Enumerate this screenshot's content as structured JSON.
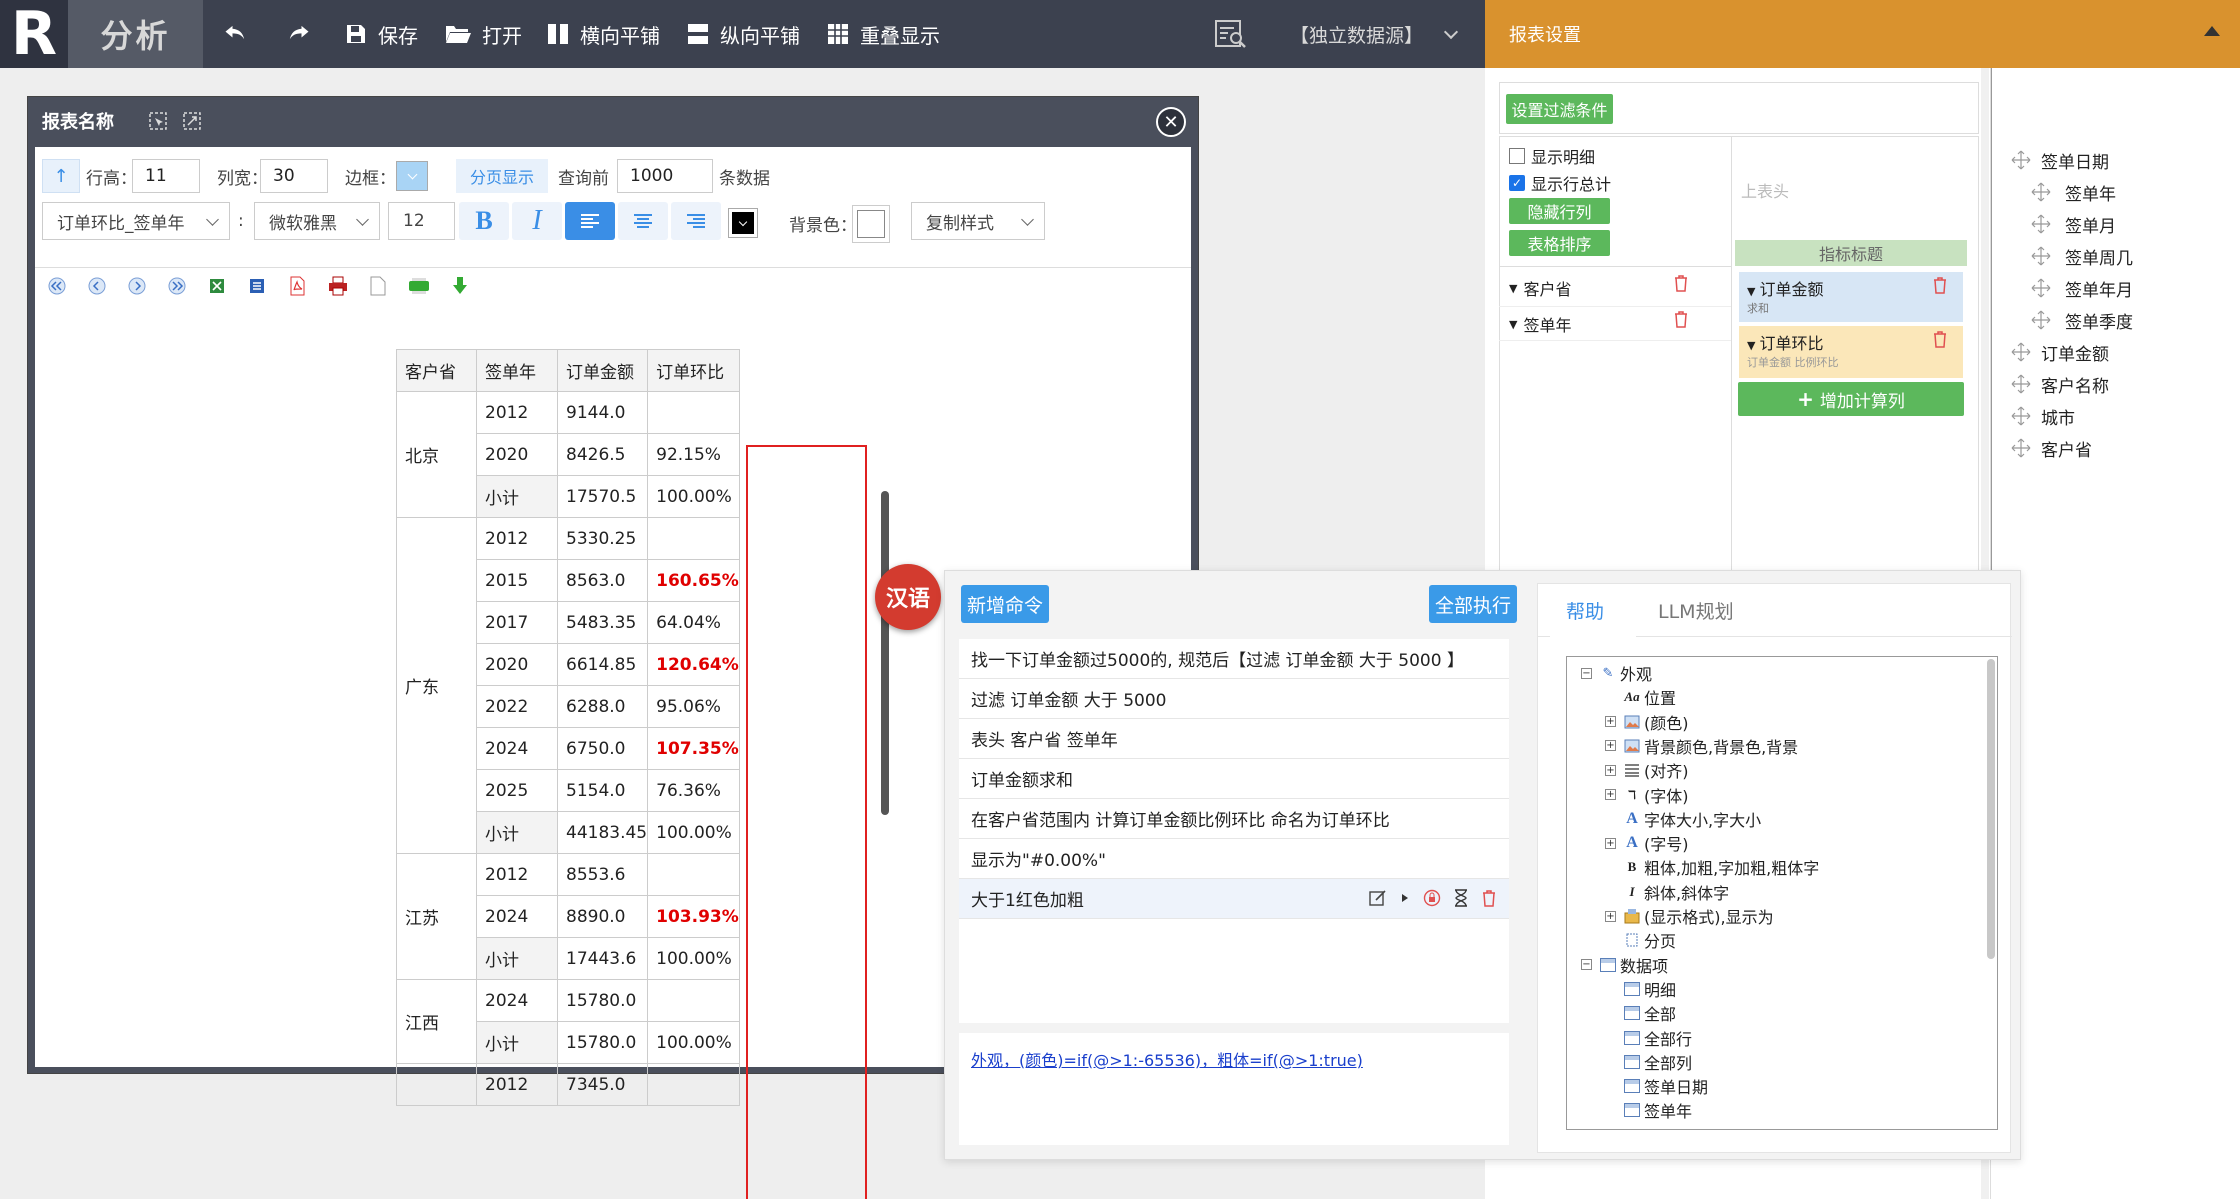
{
  "app": {
    "logo": "R",
    "title": "分析"
  },
  "toolbar": {
    "save": "保存",
    "open": "打开",
    "h_tile": "横向平铺",
    "v_tile": "纵向平铺",
    "overlap": "重叠显示",
    "datasource": "【独立数据源】"
  },
  "settings": {
    "header": "报表设置",
    "filter_btn": "设置过滤条件",
    "show_detail": "显示明细",
    "show_row_total": "显示行总计",
    "hide_rowcol": "隐藏行列",
    "table_sort": "表格排序",
    "upper_header": "上表头",
    "measure_title": "指标标题",
    "row_fields": [
      "客户省",
      "签单年"
    ],
    "measures": [
      {
        "name": "订单金额",
        "sub": "求和"
      },
      {
        "name": "订单环比",
        "sub": "订单金额 比例环比"
      }
    ],
    "add_calc": "增加计算列"
  },
  "fields": {
    "items": [
      {
        "label": "签单日期",
        "sub": false
      },
      {
        "label": "签单年",
        "sub": true
      },
      {
        "label": "签单月",
        "sub": true
      },
      {
        "label": "签单周几",
        "sub": true
      },
      {
        "label": "签单年月",
        "sub": true
      },
      {
        "label": "签单季度",
        "sub": true
      },
      {
        "label": "订单金额",
        "sub": false
      },
      {
        "label": "客户名称",
        "sub": false
      },
      {
        "label": "城市",
        "sub": false
      },
      {
        "label": "客户省",
        "sub": false
      }
    ]
  },
  "report": {
    "title": "报表名称",
    "row_height_label": "行高：",
    "row_height": "11",
    "col_width_label": "列宽：",
    "col_width": "30",
    "border_label": "边框：",
    "paging": "分页显示",
    "query_label": "查询前",
    "query_count": "1000",
    "rows_label": "条数据",
    "sheet_select": "订单环比_签单年",
    "colon": ":",
    "font_select": "微软雅黑",
    "font_size": "12",
    "bold": "B",
    "italic": "I",
    "bg_label": "背景色：",
    "copy_style": "复制样式",
    "table": {
      "headers": [
        "客户省",
        "签单年",
        "订单金额",
        "订单环比"
      ],
      "groups": [
        {
          "province": "北京",
          "rows": [
            {
              "year": "2012",
              "amount": "9144.0",
              "ratio": "",
              "red": false
            },
            {
              "year": "2020",
              "amount": "8426.5",
              "ratio": "92.15%",
              "red": false
            },
            {
              "year": "小计",
              "amount": "17570.5",
              "ratio": "100.00%",
              "red": false
            }
          ]
        },
        {
          "province": "广东",
          "rows": [
            {
              "year": "2012",
              "amount": "5330.25",
              "ratio": "",
              "red": false
            },
            {
              "year": "2015",
              "amount": "8563.0",
              "ratio": "160.65%",
              "red": true
            },
            {
              "year": "2017",
              "amount": "5483.35",
              "ratio": "64.04%",
              "red": false
            },
            {
              "year": "2020",
              "amount": "6614.85",
              "ratio": "120.64%",
              "red": true
            },
            {
              "year": "2022",
              "amount": "6288.0",
              "ratio": "95.06%",
              "red": false
            },
            {
              "year": "2024",
              "amount": "6750.0",
              "ratio": "107.35%",
              "red": true
            },
            {
              "year": "2025",
              "amount": "5154.0",
              "ratio": "76.36%",
              "red": false
            },
            {
              "year": "小计",
              "amount": "44183.45",
              "ratio": "100.00%",
              "red": false
            }
          ]
        },
        {
          "province": "江苏",
          "rows": [
            {
              "year": "2012",
              "amount": "8553.6",
              "ratio": "",
              "red": false
            },
            {
              "year": "2024",
              "amount": "8890.0",
              "ratio": "103.93%",
              "red": true
            },
            {
              "year": "小计",
              "amount": "17443.6",
              "ratio": "100.00%",
              "red": false
            }
          ]
        },
        {
          "province": "江西",
          "rows": [
            {
              "year": "2024",
              "amount": "15780.0",
              "ratio": "",
              "red": false
            },
            {
              "year": "小计",
              "amount": "15780.0",
              "ratio": "100.00%",
              "red": false
            }
          ]
        },
        {
          "province": "",
          "rows": [
            {
              "year": "2012",
              "amount": "7345.0",
              "ratio": "",
              "red": false
            }
          ]
        }
      ]
    }
  },
  "llm": {
    "lang_badge": "汉语",
    "new_cmd": "新增命令",
    "run_all": "全部执行",
    "commands": [
      "找一下订单金额过5000的, 规范后【过滤 订单金额 大于 5000 】",
      "过滤 订单金额 大于 5000",
      "表头 客户省 签单年",
      "订单金额求和",
      "在客户省范围内 计算订单金额比例环比 命名为订单环比",
      "显示为\"#0.00%\"",
      "大于1红色加粗"
    ],
    "formula": "外观，(颜色)=if(@>1:-65536)，粗体=if(@>1:true)",
    "tabs": [
      "帮助",
      "LLM规划"
    ],
    "tree": [
      {
        "label": "外观",
        "level": 0,
        "pm": "⊟",
        "icon": "pen"
      },
      {
        "label": "位置",
        "level": 1,
        "pm": "",
        "icon": "Aa"
      },
      {
        "label": "(颜色)",
        "level": 1,
        "pm": "⊞",
        "icon": "img"
      },
      {
        "label": "背景颜色,背景色,背景",
        "level": 1,
        "pm": "⊞",
        "icon": "img"
      },
      {
        "label": "(对齐)",
        "level": 1,
        "pm": "⊞",
        "icon": "align"
      },
      {
        "label": "(字体)",
        "level": 1,
        "pm": "⊞",
        "icon": "font"
      },
      {
        "label": "字体大小,字大小",
        "level": 1,
        "pm": "",
        "icon": "A"
      },
      {
        "label": "(字号)",
        "level": 1,
        "pm": "⊞",
        "icon": "A"
      },
      {
        "label": "粗体,加粗,字加粗,粗体字",
        "level": 1,
        "pm": "",
        "icon": "B"
      },
      {
        "label": "斜体,斜体字",
        "level": 1,
        "pm": "",
        "icon": "I"
      },
      {
        "label": "(显示格式),显示为",
        "level": 1,
        "pm": "⊞",
        "icon": "fmt"
      },
      {
        "label": "分页",
        "level": 1,
        "pm": "",
        "icon": "page"
      },
      {
        "label": "数据项",
        "level": 0,
        "pm": "⊟",
        "icon": "tbl"
      },
      {
        "label": "明细",
        "level": 1,
        "pm": "",
        "icon": "tbl"
      },
      {
        "label": "全部",
        "level": 1,
        "pm": "",
        "icon": "tbl"
      },
      {
        "label": "全部行",
        "level": 1,
        "pm": "",
        "icon": "tbl"
      },
      {
        "label": "全部列",
        "level": 1,
        "pm": "",
        "icon": "tbl"
      },
      {
        "label": "签单日期",
        "level": 1,
        "pm": "",
        "icon": "tbl"
      },
      {
        "label": "签单年",
        "level": 1,
        "pm": "",
        "icon": "tbl"
      }
    ]
  },
  "colors": {
    "topbar": "#3c414f",
    "accent": "#d9922e",
    "green": "#5cb85c",
    "blue": "#3a9ae8",
    "red": "#e00000"
  }
}
